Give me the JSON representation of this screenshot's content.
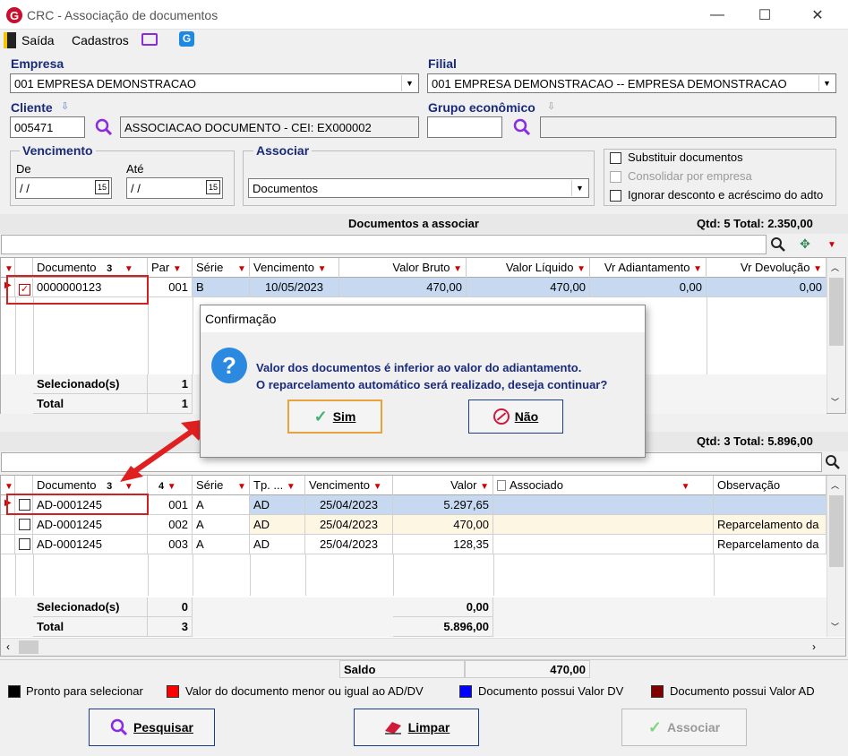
{
  "window": {
    "title": "CRC - Associação de documentos",
    "minimize": "—",
    "maximize": "☐",
    "close": "✕"
  },
  "menu": {
    "exit": "Saída",
    "cadastros": "Cadastros"
  },
  "filters": {
    "empresa_label": "Empresa",
    "empresa_value": "001 EMPRESA DEMONSTRACAO",
    "filial_label": "Filial",
    "filial_value": "001 EMPRESA DEMONSTRACAO -- EMPRESA DEMONSTRACAO",
    "cliente_label": "Cliente",
    "cliente_code": "005471",
    "cliente_name": "ASSOCIACAO DOCUMENTO - CEI: EX000002",
    "grupo_label": "Grupo econômico",
    "grupo_code": "",
    "grupo_name": "",
    "vencimento_label": "Vencimento",
    "de_label": "De",
    "ate_label": "Até",
    "de_value": " / /",
    "ate_value": " / /",
    "associar_label": "Associar",
    "associar_value": "Documentos",
    "opt_substituir": "Substituir documentos",
    "opt_consolidar": "Consolidar por empresa",
    "opt_ignorar": "Ignorar desconto e acréscimo do adto"
  },
  "docs": {
    "title": "Documentos a associar",
    "summary": "Qtd: 5 Total: 2.350,00",
    "columns": {
      "doc": "Documento",
      "sort": "3",
      "par": "Par",
      "serie": "Série",
      "venc": "Vencimento",
      "bruto": "Valor Bruto",
      "liquido": "Valor Líquido",
      "adiant": "Vr Adiantamento",
      "devol": "Vr Devolução"
    },
    "rows": [
      {
        "doc": "0000000123",
        "par": "001",
        "serie": "B",
        "venc": "10/05/2023",
        "bruto": "470,00",
        "liquido": "470,00",
        "adiant": "0,00",
        "devol": "0,00"
      }
    ],
    "selected_label": "Selecionado(s)",
    "selected_count": "1",
    "total_label": "Total",
    "total_count": "1"
  },
  "adto": {
    "summary": "Qtd: 3 Total: 5.896,00",
    "columns": {
      "doc": "Documento",
      "sort1": "3",
      "sort2": "4",
      "serie": "Série",
      "tp": "Tp. ...",
      "venc": "Vencimento",
      "valor": "Valor",
      "assoc": "Associado",
      "obs": "Observação"
    },
    "rows": [
      {
        "doc": "AD-0001245",
        "par": "001",
        "serie": "A",
        "tp": "AD",
        "venc": "25/04/2023",
        "valor": "5.297,65",
        "obs": ""
      },
      {
        "doc": "AD-0001245",
        "par": "002",
        "serie": "A",
        "tp": "AD",
        "venc": "25/04/2023",
        "valor": "470,00",
        "obs": "Reparcelamento da"
      },
      {
        "doc": "AD-0001245",
        "par": "003",
        "serie": "A",
        "tp": "AD",
        "venc": "25/04/2023",
        "valor": "128,35",
        "obs": "Reparcelamento da"
      }
    ],
    "selected_label": "Selecionado(s)",
    "selected_count": "0",
    "selected_valor": "0,00",
    "total_label": "Total",
    "total_count": "3",
    "total_valor": "5.896,00"
  },
  "saldo": {
    "label": "Saldo",
    "value": "470,00"
  },
  "legend": [
    {
      "color": "#000000",
      "text": "Pronto para selecionar"
    },
    {
      "color": "#ff0000",
      "text": "Valor do documento menor ou igual ao AD/DV"
    },
    {
      "color": "#0000ff",
      "text": "Documento possui Valor DV"
    },
    {
      "color": "#800000",
      "text": "Documento possui Valor AD"
    }
  ],
  "buttons": {
    "pesquisar": "Pesquisar",
    "limpar": "Limpar",
    "associar": "Associar"
  },
  "dialog": {
    "title": "Confirmação",
    "line1": "Valor dos documentos é inferior ao valor do adiantamento.",
    "line2": "O reparcelamento automático será realizado, deseja continuar?",
    "yes": "Sim",
    "no": "Não"
  }
}
